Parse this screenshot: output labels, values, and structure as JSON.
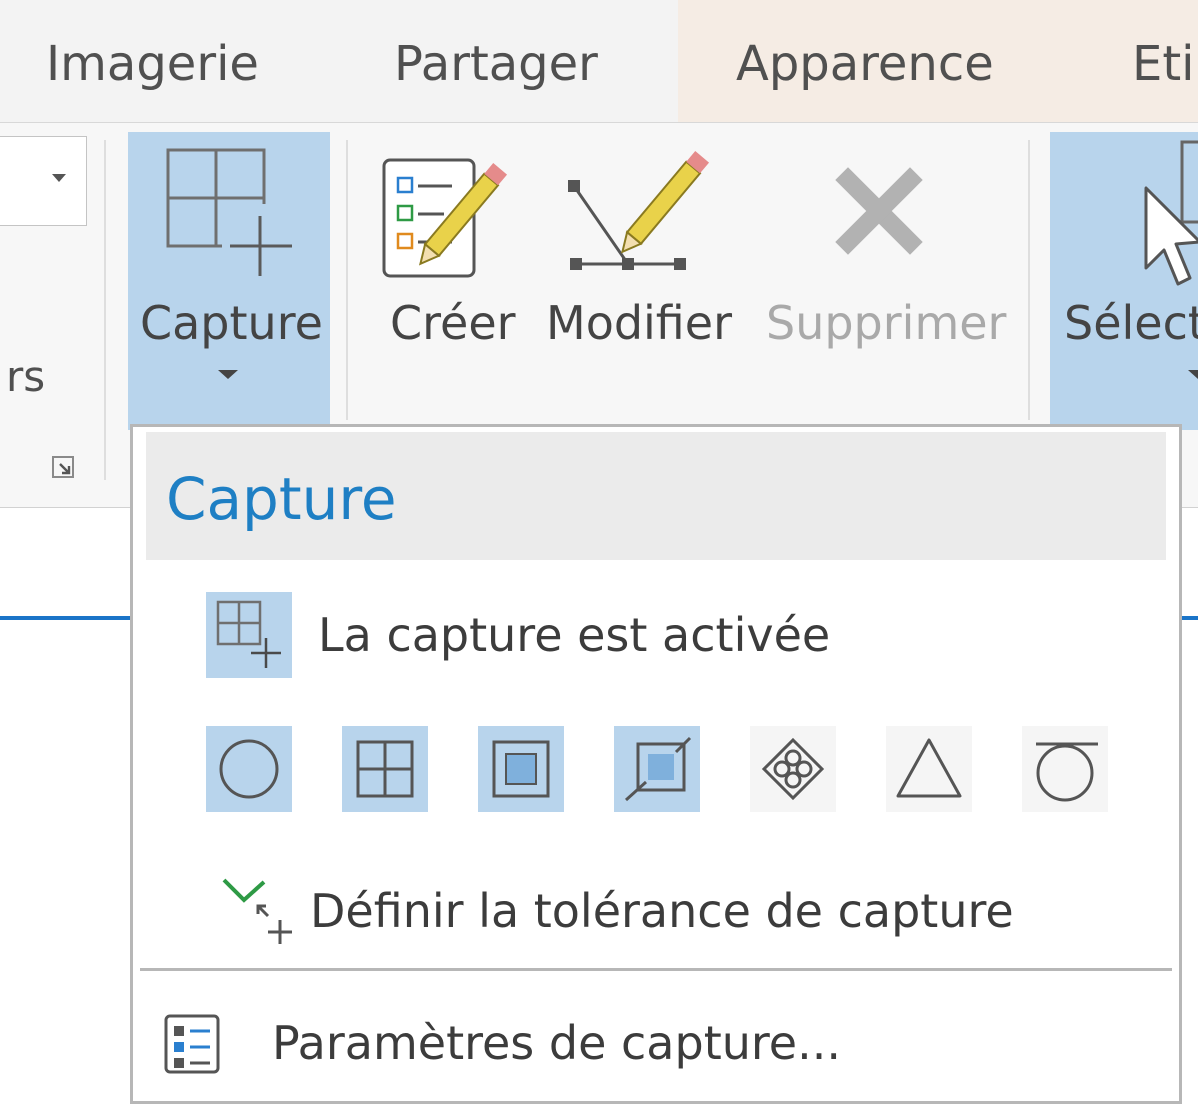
{
  "tabs": [
    {
      "label": "Imagerie"
    },
    {
      "label": "Partager"
    },
    {
      "label": "Apparence"
    },
    {
      "label": "Eti"
    }
  ],
  "ribbon": {
    "partial_group_label": "rs",
    "buttons": {
      "capture": {
        "label": "Capture",
        "active": true
      },
      "create": {
        "label": "Créer"
      },
      "modify": {
        "label": "Modifier"
      },
      "delete": {
        "label": "Supprimer",
        "enabled": false
      },
      "select": {
        "label": "Sélect",
        "active": true
      }
    }
  },
  "menu": {
    "title": "Capture",
    "toggle_snapping": {
      "label": "La capture est activée",
      "checked": true
    },
    "snap_modes": [
      {
        "icon": "point-snap-icon",
        "active": true
      },
      {
        "icon": "edge-snap-icon",
        "active": true
      },
      {
        "icon": "vertex-snap-icon",
        "active": true
      },
      {
        "icon": "endpoint-snap-icon",
        "active": true
      },
      {
        "icon": "intersection-snap-icon",
        "active": false
      },
      {
        "icon": "midpoint-snap-icon",
        "active": false
      },
      {
        "icon": "tangent-snap-icon",
        "active": false
      }
    ],
    "tolerance": {
      "label": "Définir la tolérance de capture"
    },
    "settings": {
      "label": "Paramètres de capture..."
    }
  },
  "colors": {
    "accent": "#1e7fc4",
    "active_tile": "#b8d4ec",
    "contextual_tab": "#f5ece4"
  }
}
